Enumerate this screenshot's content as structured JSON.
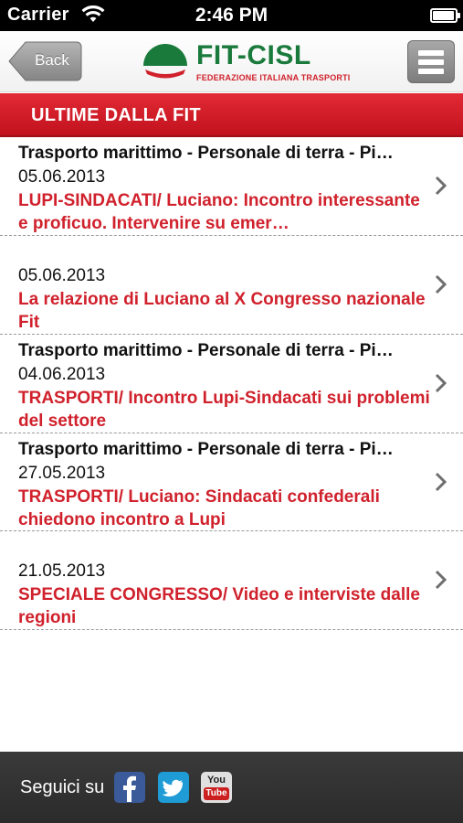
{
  "status_bar": {
    "carrier": "Carrier",
    "time": "2:46 PM"
  },
  "nav": {
    "back_label": "Back",
    "logo_title": "FIT-CISL",
    "logo_subtitle": "FEDERAZIONE ITALIANA TRASPORTI"
  },
  "section": {
    "title": "ULTIME DALLA FIT"
  },
  "news": [
    {
      "category": "Trasporto marittimo - Personale di terra - Pi…",
      "date": "05.06.2013",
      "headline": "LUPI-SINDACATI/ Luciano: Incontro interessante e proficuo. Intervenire su emer…"
    },
    {
      "category": "",
      "date": "05.06.2013",
      "headline": "La relazione di Luciano al X Congresso nazionale Fit"
    },
    {
      "category": "Trasporto marittimo - Personale di terra - Pi…",
      "date": "04.06.2013",
      "headline": "TRASPORTI/ Incontro Lupi-Sindacati sui problemi del settore"
    },
    {
      "category": "Trasporto marittimo - Personale di terra - Pi…",
      "date": "27.05.2013",
      "headline": "TRASPORTI/ Luciano: Sindacati confederali chiedono incontro a Lupi"
    },
    {
      "category": "",
      "date": "21.05.2013",
      "headline": "SPECIALE CONGRESSO/ Video e interviste dalle regioni"
    }
  ],
  "footer": {
    "follow_label": "Seguici su",
    "youtube_top": "You",
    "youtube_bottom": "Tube",
    "icons": [
      "facebook-icon",
      "twitter-icon",
      "youtube-icon"
    ]
  },
  "colors": {
    "brand_red": "#d0212c",
    "brand_green": "#1a7a3c",
    "footer_bg": "#2f2f2f"
  }
}
